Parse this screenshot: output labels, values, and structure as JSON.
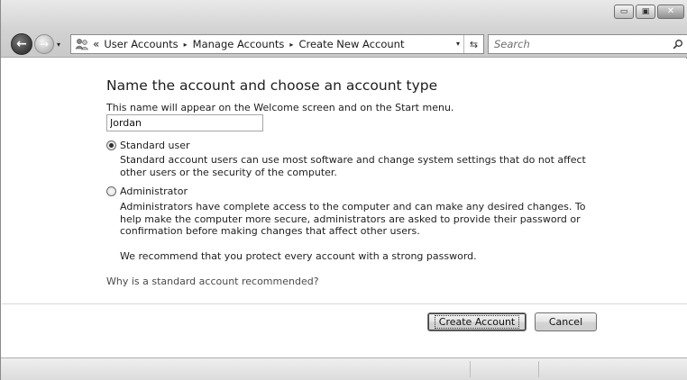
{
  "window": {
    "caption": {
      "minimize_glyph": "▭",
      "maximize_glyph": "▣",
      "close_glyph": "✕"
    }
  },
  "nav": {
    "back_glyph": "←",
    "forward_glyph": "→",
    "history_glyph": "▾"
  },
  "address": {
    "chevron": "«",
    "breadcrumbs": [
      "User Accounts",
      "Manage Accounts",
      "Create New Account"
    ],
    "separator": "▸",
    "dropdown_glyph": "▾",
    "refresh_glyph": "⇆"
  },
  "search": {
    "placeholder": "Search"
  },
  "form": {
    "heading": "Name the account and choose an account type",
    "name_hint": "This name will appear on the Welcome screen and on the Start menu.",
    "name_value": "Jordan",
    "options": [
      {
        "label": "Standard user",
        "checked": true,
        "description": "Standard account users can use most software and change system settings that do not affect other users or the security of the computer."
      },
      {
        "label": "Administrator",
        "checked": false,
        "description": "Administrators have complete access to the computer and can make any desired changes. To help make the computer more secure, administrators are asked to provide their password or confirmation before making changes that affect other users."
      }
    ],
    "recommendation": "We recommend that you protect every account with a strong password.",
    "help_link": "Why is a standard account recommended?"
  },
  "buttons": {
    "create": "Create Account",
    "cancel": "Cancel"
  }
}
